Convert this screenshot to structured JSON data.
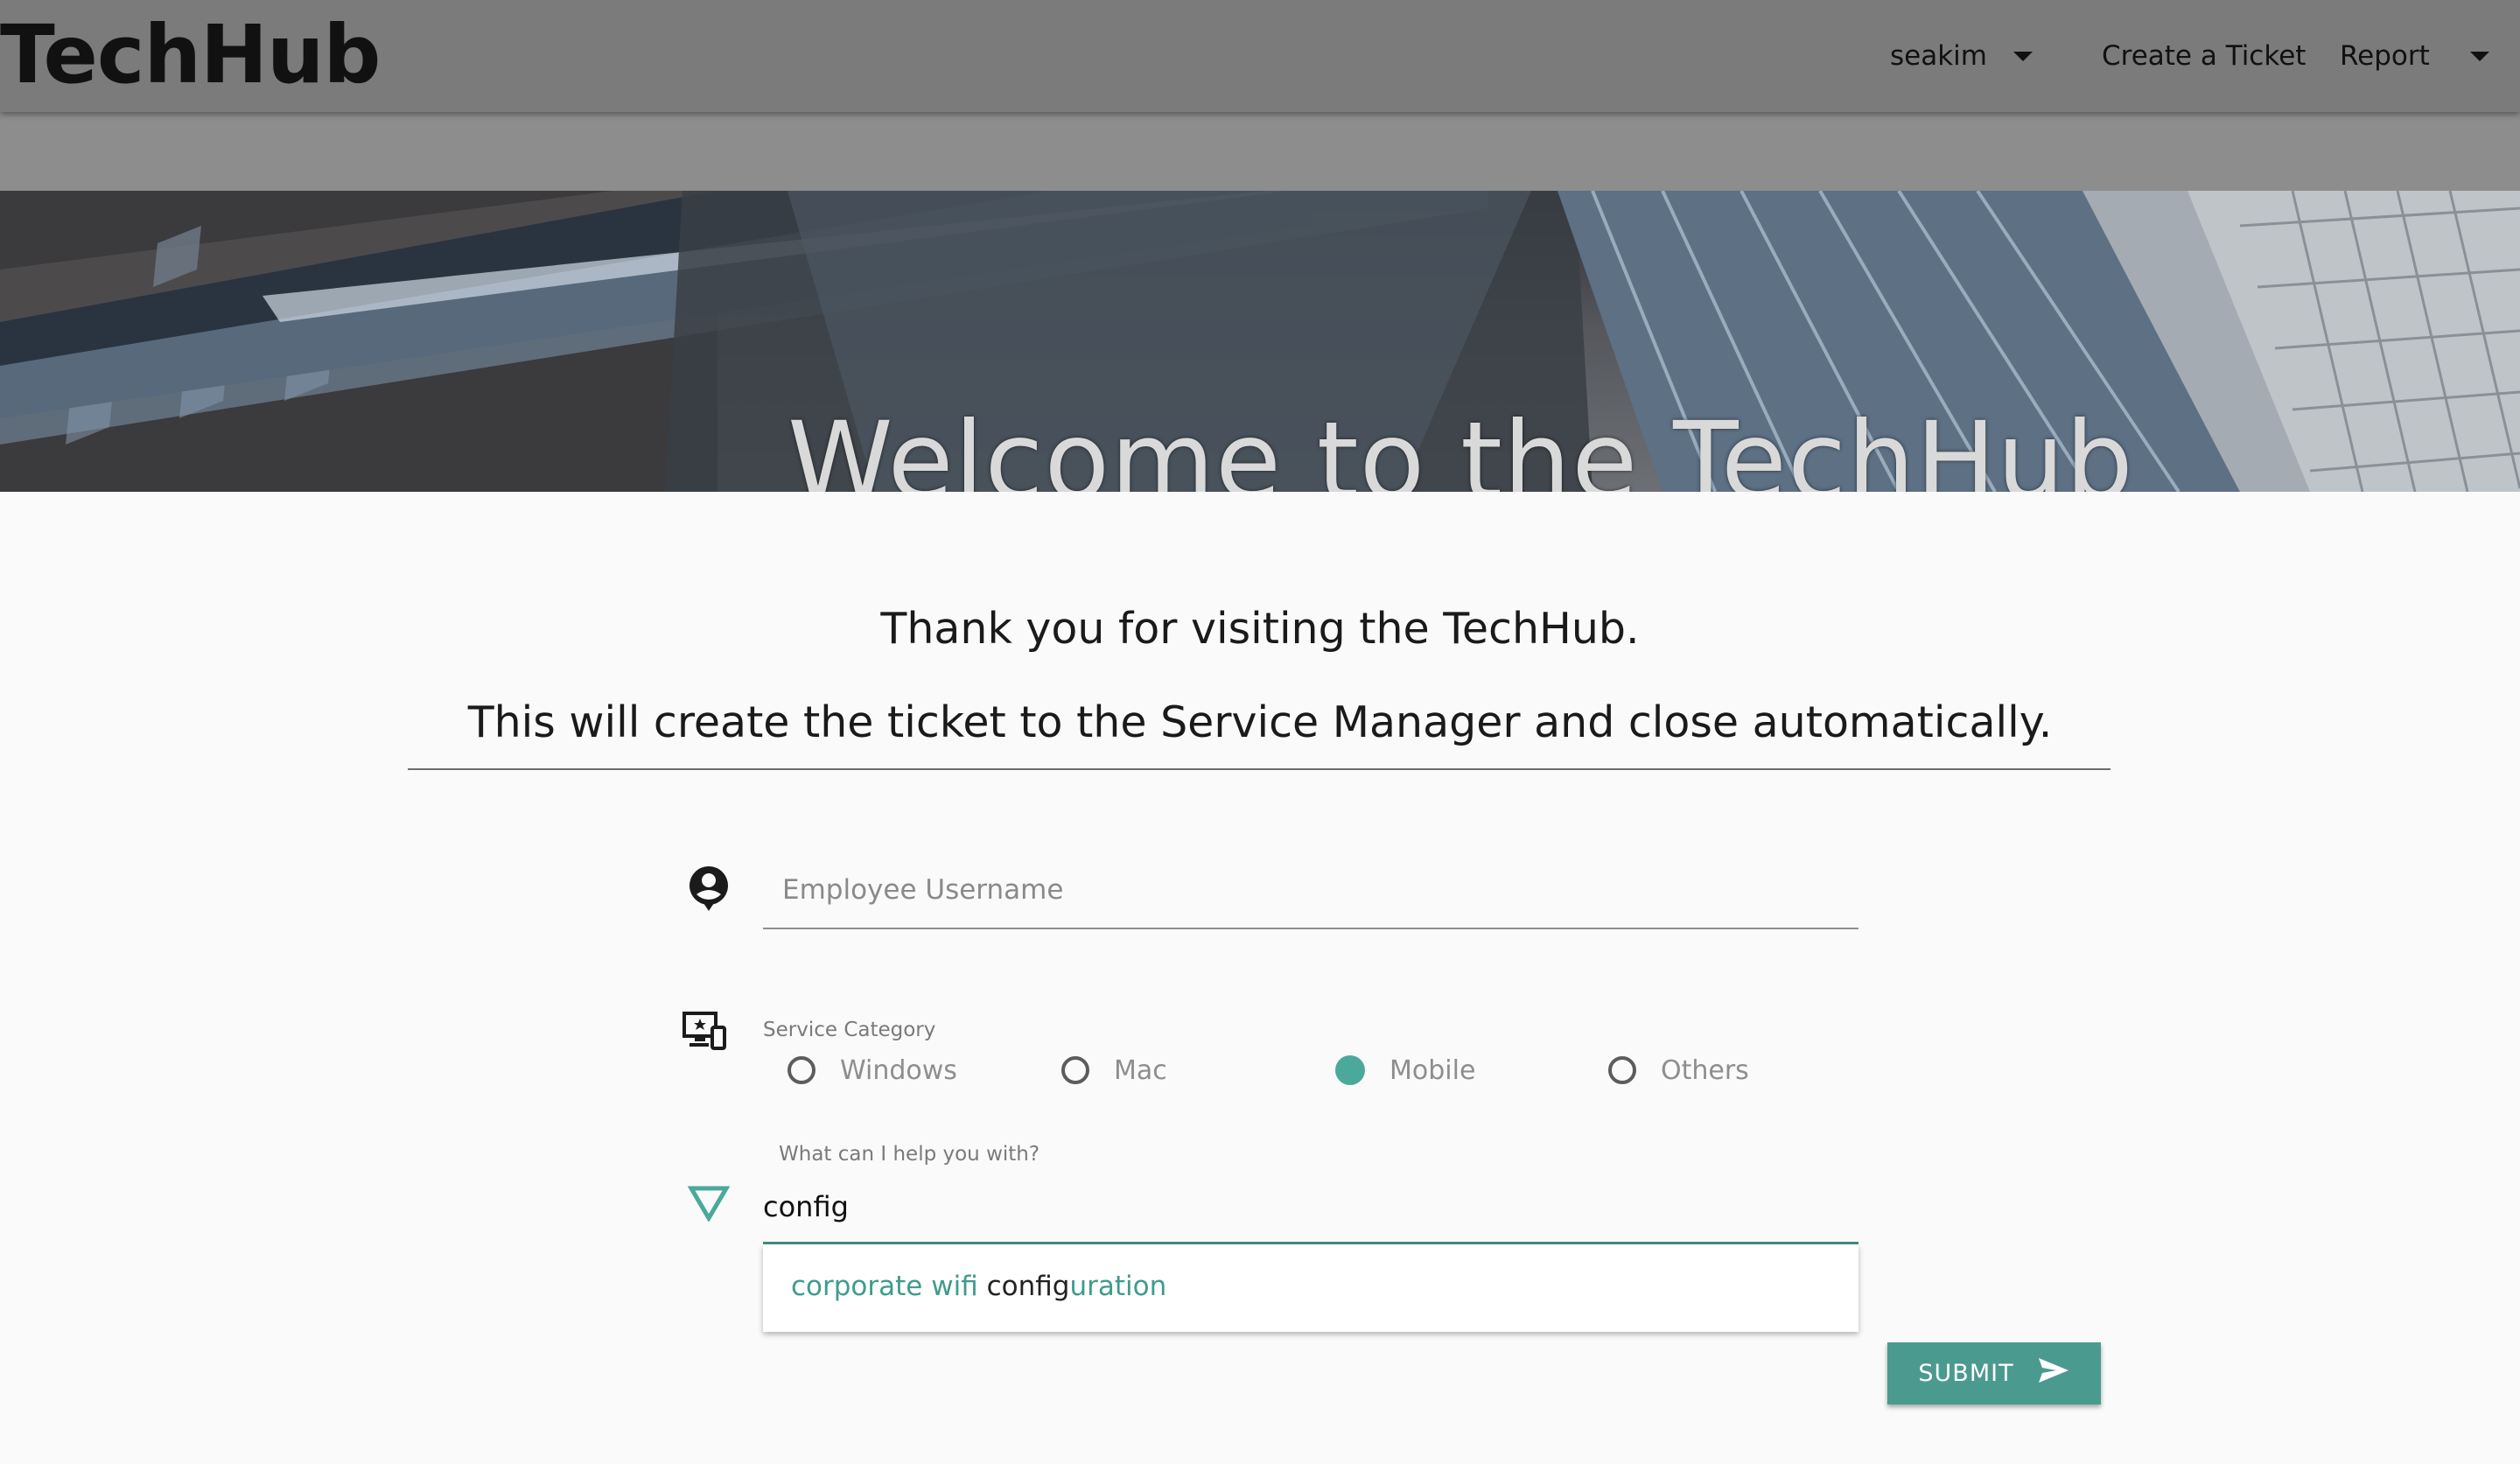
{
  "header": {
    "brand": "TechHub",
    "nav": {
      "user": "seakim",
      "create_ticket": "Create a Ticket",
      "report": "Report"
    }
  },
  "hero": {
    "title": "Welcome to the TechHub"
  },
  "intro": {
    "line1": "Thank you for visiting the TechHub.",
    "line2": "This will create the ticket to the Service Manager and close automatically."
  },
  "form": {
    "username": {
      "placeholder": "Employee Username",
      "value": ""
    },
    "service_category": {
      "label": "Service Category",
      "options": [
        "Windows",
        "Mac",
        "Mobile",
        "Others"
      ],
      "selected": "Mobile"
    },
    "help": {
      "label": "What can I help you with?",
      "value": "config"
    },
    "suggestion": {
      "before": "corporate wifi ",
      "match": "config",
      "after": "uration"
    },
    "submit_label": "SUBMIT"
  },
  "colors": {
    "accent": "#4aa99b",
    "header_bg": "#7b7b7b",
    "subbar_bg": "#8d8d8d"
  },
  "icons": {
    "user": "account-circle-icon",
    "category": "devices-icon",
    "help": "triangle-down-outline-icon",
    "submit": "send-icon",
    "dropdown": "caret-down-icon"
  }
}
